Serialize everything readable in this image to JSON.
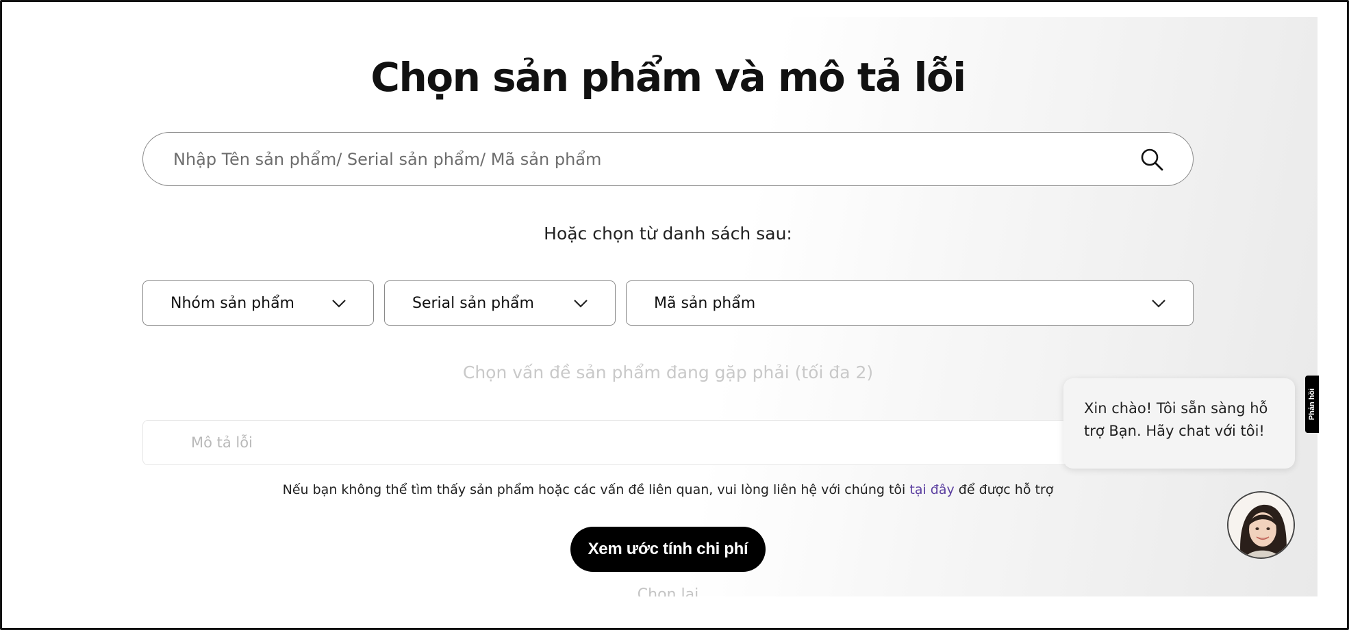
{
  "page": {
    "title": "Chọn sản phẩm và mô tả lỗi"
  },
  "search": {
    "placeholder": "Nhập Tên sản phẩm/ Serial sản phẩm/ Mã sản phẩm",
    "icon": "search-icon"
  },
  "or_choose_label": "Hoặc chọn từ danh sách sau:",
  "selects": {
    "product_group": "Nhóm sản phẩm",
    "product_serial": "Serial sản phẩm",
    "product_code": "Mã sản phẩm"
  },
  "issue_label": "Chọn vấn đề sản phẩm đang gặp phải (tối đa 2)",
  "description": {
    "placeholder": "Mô tả lỗi"
  },
  "help": {
    "before": "Nếu bạn không thể tìm thấy sản phẩm hoặc các vấn đề liên quan, vui lòng liên hệ với chúng tôi ",
    "link": "tại đây",
    "after": " để được hỗ trợ"
  },
  "cta_label": "Xem ước tính chi phí",
  "reset_label": "Chọn lại",
  "chat": {
    "greeting": "Xin chào! Tôi sẵn sàng hỗ trợ Bạn. Hãy chat với tôi!"
  },
  "feedback_tab_label": "Phản hồi",
  "colors": {
    "accent_link": "#5b3fa0",
    "button_bg": "#000000",
    "border": "#8a8a8a"
  }
}
